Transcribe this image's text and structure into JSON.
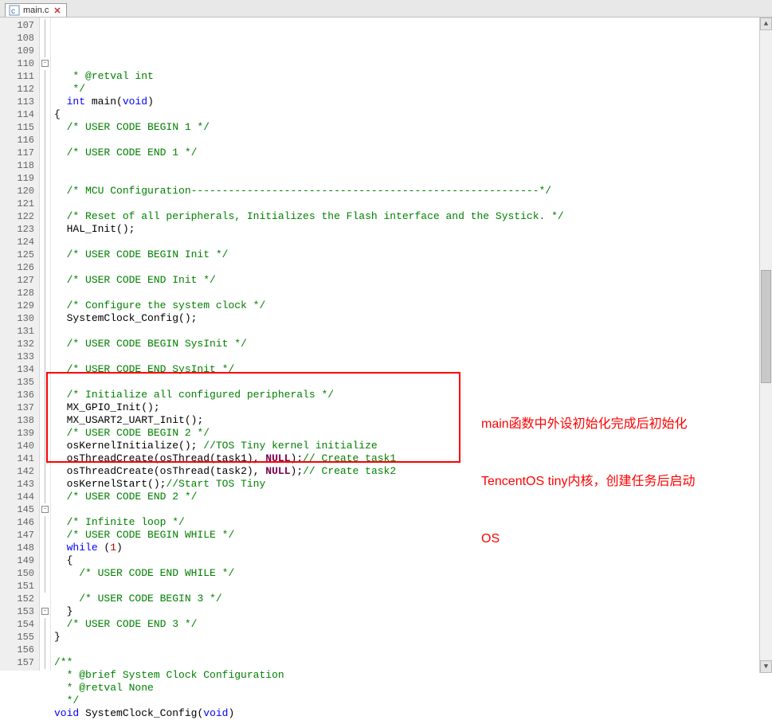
{
  "tab": {
    "filename": "main.c",
    "close_glyph": "✕"
  },
  "line_start": 107,
  "lines": [
    {
      "n": 107,
      "fold": "ln",
      "tokens": [
        [
          "plain",
          "   "
        ],
        [
          "c",
          "* "
        ],
        [
          "c",
          "@retval"
        ],
        [
          "c",
          " int"
        ]
      ]
    },
    {
      "n": 108,
      "fold": "ln",
      "tokens": [
        [
          "plain",
          "   "
        ],
        [
          "c",
          "*/"
        ]
      ]
    },
    {
      "n": 109,
      "fold": "ln",
      "tokens": [
        [
          "plain",
          "  "
        ],
        [
          "t",
          "int"
        ],
        [
          "plain",
          " "
        ],
        [
          "fn",
          "main"
        ],
        [
          "plain",
          "("
        ],
        [
          "t",
          "void"
        ],
        [
          "plain",
          ")"
        ]
      ]
    },
    {
      "n": 110,
      "fold": "box",
      "tokens": [
        [
          "plain",
          "{"
        ]
      ]
    },
    {
      "n": 111,
      "fold": "ln",
      "tokens": [
        [
          "plain",
          "  "
        ],
        [
          "c",
          "/* USER CODE BEGIN 1 */"
        ]
      ]
    },
    {
      "n": 112,
      "fold": "ln",
      "tokens": []
    },
    {
      "n": 113,
      "fold": "ln",
      "tokens": [
        [
          "plain",
          "  "
        ],
        [
          "c",
          "/* USER CODE END 1 */"
        ]
      ]
    },
    {
      "n": 114,
      "fold": "ln",
      "tokens": []
    },
    {
      "n": 115,
      "fold": "ln",
      "tokens": []
    },
    {
      "n": 116,
      "fold": "ln",
      "tokens": [
        [
          "plain",
          "  "
        ],
        [
          "c",
          "/* MCU Configuration--------------------------------------------------------*/"
        ]
      ]
    },
    {
      "n": 117,
      "fold": "ln",
      "tokens": []
    },
    {
      "n": 118,
      "fold": "ln",
      "tokens": [
        [
          "plain",
          "  "
        ],
        [
          "c",
          "/* Reset of all peripherals, Initializes the Flash interface and the Systick. */"
        ]
      ]
    },
    {
      "n": 119,
      "fold": "ln",
      "tokens": [
        [
          "plain",
          "  "
        ],
        [
          "fn",
          "HAL_Init"
        ],
        [
          "plain",
          "();"
        ]
      ]
    },
    {
      "n": 120,
      "fold": "ln",
      "tokens": []
    },
    {
      "n": 121,
      "fold": "ln",
      "tokens": [
        [
          "plain",
          "  "
        ],
        [
          "c",
          "/* USER CODE BEGIN Init */"
        ]
      ]
    },
    {
      "n": 122,
      "fold": "ln",
      "tokens": []
    },
    {
      "n": 123,
      "fold": "ln",
      "tokens": [
        [
          "plain",
          "  "
        ],
        [
          "c",
          "/* USER CODE END Init */"
        ]
      ]
    },
    {
      "n": 124,
      "fold": "ln",
      "tokens": []
    },
    {
      "n": 125,
      "fold": "ln",
      "tokens": [
        [
          "plain",
          "  "
        ],
        [
          "c",
          "/* Configure the system clock */"
        ]
      ]
    },
    {
      "n": 126,
      "fold": "ln",
      "tokens": [
        [
          "plain",
          "  "
        ],
        [
          "fn",
          "SystemClock_Config"
        ],
        [
          "plain",
          "();"
        ]
      ]
    },
    {
      "n": 127,
      "fold": "ln",
      "tokens": []
    },
    {
      "n": 128,
      "fold": "ln",
      "tokens": [
        [
          "plain",
          "  "
        ],
        [
          "c",
          "/* USER CODE BEGIN SysInit */"
        ]
      ]
    },
    {
      "n": 129,
      "fold": "ln",
      "tokens": []
    },
    {
      "n": 130,
      "fold": "ln",
      "tokens": [
        [
          "plain",
          "  "
        ],
        [
          "c",
          "/* USER CODE END SysInit */"
        ]
      ]
    },
    {
      "n": 131,
      "fold": "ln",
      "tokens": []
    },
    {
      "n": 132,
      "fold": "ln",
      "tokens": [
        [
          "plain",
          "  "
        ],
        [
          "c",
          "/* Initialize all configured peripherals */"
        ]
      ]
    },
    {
      "n": 133,
      "fold": "ln",
      "tokens": [
        [
          "plain",
          "  "
        ],
        [
          "fn",
          "MX_GPIO_Init"
        ],
        [
          "plain",
          "();"
        ]
      ]
    },
    {
      "n": 134,
      "fold": "ln",
      "tokens": [
        [
          "plain",
          "  "
        ],
        [
          "fn",
          "MX_USART2_UART_Init"
        ],
        [
          "plain",
          "();"
        ]
      ]
    },
    {
      "n": 135,
      "fold": "ln",
      "tokens": [
        [
          "plain",
          "  "
        ],
        [
          "c",
          "/* USER CODE BEGIN 2 */"
        ]
      ]
    },
    {
      "n": 136,
      "fold": "ln",
      "tokens": [
        [
          "plain",
          "  "
        ],
        [
          "fn",
          "osKernelInitialize"
        ],
        [
          "plain",
          "(); "
        ],
        [
          "c",
          "//TOS Tiny kernel initialize"
        ]
      ]
    },
    {
      "n": 137,
      "fold": "ln",
      "tokens": [
        [
          "plain",
          "  "
        ],
        [
          "fn",
          "osThreadCreate"
        ],
        [
          "plain",
          "("
        ],
        [
          "fn",
          "osThread"
        ],
        [
          "plain",
          "("
        ],
        [
          "plain",
          "task1"
        ],
        [
          "plain",
          "), "
        ],
        [
          "kw2",
          "NULL"
        ],
        [
          "plain",
          ");"
        ],
        [
          "c",
          "// Create task1"
        ]
      ]
    },
    {
      "n": 138,
      "fold": "ln",
      "tokens": [
        [
          "plain",
          "  "
        ],
        [
          "fn",
          "osThreadCreate"
        ],
        [
          "plain",
          "("
        ],
        [
          "fn",
          "osThread"
        ],
        [
          "plain",
          "("
        ],
        [
          "plain",
          "task2"
        ],
        [
          "plain",
          "), "
        ],
        [
          "kw2",
          "NULL"
        ],
        [
          "plain",
          ");"
        ],
        [
          "c",
          "// Create task2"
        ]
      ]
    },
    {
      "n": 139,
      "fold": "ln",
      "tokens": [
        [
          "plain",
          "  "
        ],
        [
          "fn",
          "osKernelStart"
        ],
        [
          "plain",
          "();"
        ],
        [
          "c",
          "//Start TOS Tiny"
        ]
      ]
    },
    {
      "n": 140,
      "fold": "ln",
      "tokens": [
        [
          "plain",
          "  "
        ],
        [
          "c",
          "/* USER CODE END 2 */"
        ]
      ]
    },
    {
      "n": 141,
      "fold": "ln",
      "tokens": []
    },
    {
      "n": 142,
      "fold": "ln",
      "tokens": [
        [
          "plain",
          "  "
        ],
        [
          "c",
          "/* Infinite loop */"
        ]
      ]
    },
    {
      "n": 143,
      "fold": "ln",
      "tokens": [
        [
          "plain",
          "  "
        ],
        [
          "c",
          "/* USER CODE BEGIN WHILE */"
        ]
      ]
    },
    {
      "n": 144,
      "fold": "ln",
      "tokens": [
        [
          "plain",
          "  "
        ],
        [
          "k",
          "while"
        ],
        [
          "plain",
          " ("
        ],
        [
          "n",
          "1"
        ],
        [
          "plain",
          ")"
        ]
      ]
    },
    {
      "n": 145,
      "fold": "box",
      "tokens": [
        [
          "plain",
          "  "
        ],
        [
          "plain",
          "{"
        ]
      ]
    },
    {
      "n": 146,
      "fold": "ln",
      "tokens": [
        [
          "plain",
          "    "
        ],
        [
          "c",
          "/* USER CODE END WHILE */"
        ]
      ]
    },
    {
      "n": 147,
      "fold": "ln",
      "tokens": []
    },
    {
      "n": 148,
      "fold": "ln",
      "tokens": [
        [
          "plain",
          "    "
        ],
        [
          "c",
          "/* USER CODE BEGIN 3 */"
        ]
      ]
    },
    {
      "n": 149,
      "fold": "end",
      "tokens": [
        [
          "plain",
          "  "
        ],
        [
          "plain",
          "}"
        ]
      ]
    },
    {
      "n": 150,
      "fold": "ln",
      "tokens": [
        [
          "plain",
          "  "
        ],
        [
          "c",
          "/* USER CODE END 3 */"
        ]
      ]
    },
    {
      "n": 151,
      "fold": "end",
      "tokens": [
        [
          "plain",
          "}"
        ]
      ]
    },
    {
      "n": 152,
      "fold": "",
      "tokens": []
    },
    {
      "n": 153,
      "fold": "box",
      "tokens": [
        [
          "c",
          "/**"
        ]
      ]
    },
    {
      "n": 154,
      "fold": "ln",
      "tokens": [
        [
          "plain",
          "  "
        ],
        [
          "c",
          "* "
        ],
        [
          "c",
          "@brief"
        ],
        [
          "c",
          " System Clock Configuration"
        ]
      ]
    },
    {
      "n": 155,
      "fold": "ln",
      "tokens": [
        [
          "plain",
          "  "
        ],
        [
          "c",
          "* "
        ],
        [
          "c",
          "@retval"
        ],
        [
          "c",
          " None"
        ]
      ]
    },
    {
      "n": 156,
      "fold": "ln",
      "tokens": [
        [
          "plain",
          "  "
        ],
        [
          "c",
          "*/"
        ]
      ]
    },
    {
      "n": 157,
      "fold": "ln",
      "tokens": [
        [
          "t",
          "void"
        ],
        [
          "plain",
          " "
        ],
        [
          "fn",
          "SystemClock_Config"
        ],
        [
          "plain",
          "("
        ],
        [
          "t",
          "void"
        ],
        [
          "plain",
          ")"
        ]
      ]
    }
  ],
  "annotation": {
    "line1": "main函数中外设初始化完成后初始化",
    "line2": "TencentOS tiny内核，创建任务后启动",
    "line3": "OS"
  },
  "redbox": {
    "top_line": 135,
    "bottom_line": 141
  },
  "scrollbar": {
    "thumb_top_pct": 38,
    "thumb_height_pct": 18
  }
}
